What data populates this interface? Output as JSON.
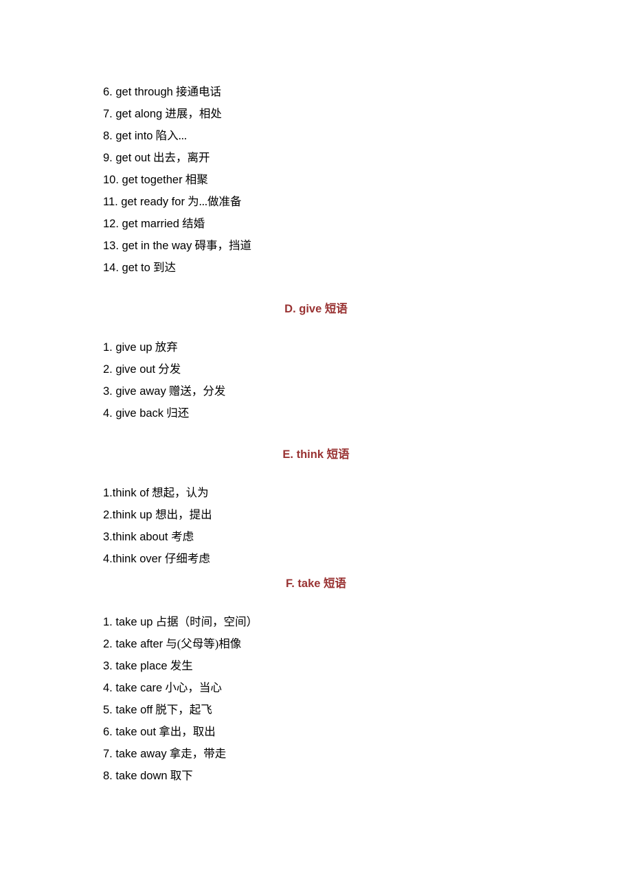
{
  "sectionC": {
    "items": [
      {
        "phrase": "6. get through",
        "meaning": " 接通电话"
      },
      {
        "phrase": "7. get along",
        "meaning": " 进展，相处"
      },
      {
        "phrase": "8. get into",
        "meaning": " 陷入..."
      },
      {
        "phrase": "9. get out",
        "meaning": " 出去，离开"
      },
      {
        "phrase": "10. get together",
        "meaning": " 相聚"
      },
      {
        "phrase": "11. get ready for",
        "meaning": " 为...做准备"
      },
      {
        "phrase": "12. get married",
        "meaning": " 结婚"
      },
      {
        "phrase": "13. get in the way",
        "meaning": " 碍事，挡道"
      },
      {
        "phrase": "14. get to",
        "meaning": " 到达"
      }
    ]
  },
  "sectionD": {
    "heading": "D. give 短语",
    "items": [
      {
        "phrase": "1. give up",
        "meaning": " 放弃"
      },
      {
        "phrase": "2. give out",
        "meaning": " 分发"
      },
      {
        "phrase": "3. give away",
        "meaning": " 赠送，分发"
      },
      {
        "phrase": "4. give back",
        "meaning": " 归还"
      }
    ]
  },
  "sectionE": {
    "heading": "E. think 短语",
    "items": [
      {
        "phrase": "1.think of",
        "meaning": " 想起，认为"
      },
      {
        "phrase": "2.think up ",
        "meaning": "想出，提出"
      },
      {
        "phrase": "3.think about ",
        "meaning": "考虑"
      },
      {
        "phrase": "4.think over ",
        "meaning": "仔细考虑"
      }
    ]
  },
  "sectionF": {
    "heading": "F. take 短语",
    "items": [
      {
        "phrase": "1. take up",
        "meaning": " 占据（时间，空间）"
      },
      {
        "phrase": "2. take after",
        "meaning": " 与(父母等)相像"
      },
      {
        "phrase": "3. take place",
        "meaning": " 发生"
      },
      {
        "phrase": "4. take care",
        "meaning": " 小心，当心"
      },
      {
        "phrase": "5. take off",
        "meaning": " 脱下，起飞"
      },
      {
        "phrase": "6. take out",
        "meaning": " 拿出，取出"
      },
      {
        "phrase": "7. take away",
        "meaning": " 拿走，带走"
      },
      {
        "phrase": "8. take down",
        "meaning": " 取下"
      }
    ]
  }
}
